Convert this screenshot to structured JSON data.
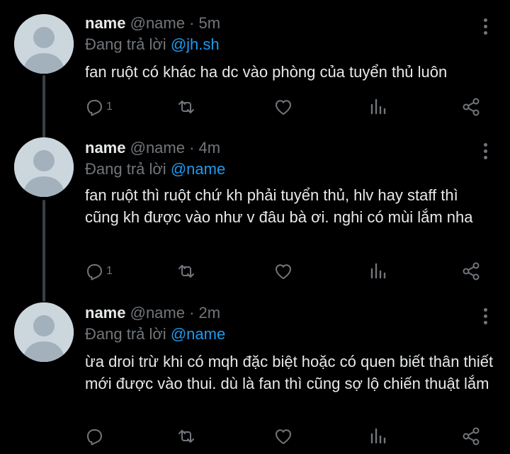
{
  "tweets": [
    {
      "name": "name",
      "handle_time": "@name · 5m",
      "reply_prefix": "Đang trả lời ",
      "reply_to": "@jh.sh",
      "text": "fan ruột có khác ha dc vào phòng của tuyển thủ luôn",
      "reply_count": "1",
      "retweet_count": "",
      "like_count": ""
    },
    {
      "name": "name",
      "handle_time": "@name · 4m",
      "reply_prefix": "Đang trả lời ",
      "reply_to": "@name",
      "text": "fan ruột thì ruột chứ kh phải tuyển thủ, hlv hay staff thì cũng kh được vào như v đâu bà ơi. nghi có mùi lắm nha",
      "reply_count": "1",
      "retweet_count": "",
      "like_count": ""
    },
    {
      "name": "name",
      "handle_time": "@name · 2m",
      "reply_prefix": "Đang trả lời ",
      "reply_to": "@name",
      "text": "ừa droi trừ khi có mqh đặc biệt hoặc có quen biết thân thiết mới được vào thui. dù là fan thì cũng sợ lộ chiến thuật lắm",
      "reply_count": "",
      "retweet_count": "",
      "like_count": ""
    }
  ],
  "icons": {
    "reply": "reply-icon",
    "retweet": "retweet-icon",
    "like": "heart-icon",
    "views": "analytics-icon",
    "share": "share-icon",
    "more": "more-icon",
    "avatar": "avatar-placeholder-icon"
  },
  "colors": {
    "background": "#000000",
    "text": "#e7e9ea",
    "muted": "#71767b",
    "mention": "#1d9bf0",
    "thread_line": "#3a3f44",
    "avatar_bg": "#ccd6dd",
    "avatar_fg": "#a3b1bd"
  }
}
